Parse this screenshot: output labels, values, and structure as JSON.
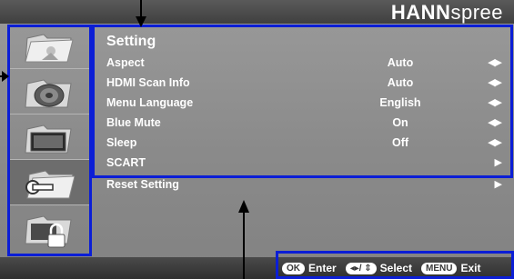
{
  "brand": {
    "bold": "HANN",
    "light": "spree"
  },
  "menu": {
    "title": "Setting",
    "items": [
      {
        "label": "Aspect",
        "value": "Auto",
        "arrows": "◀▶"
      },
      {
        "label": "HDMI Scan Info",
        "value": "Auto",
        "arrows": "◀▶"
      },
      {
        "label": "Menu Language",
        "value": "English",
        "arrows": "◀▶"
      },
      {
        "label": "Blue Mute",
        "value": "On",
        "arrows": "◀▶"
      },
      {
        "label": "Sleep",
        "value": "Off",
        "arrows": "◀▶"
      },
      {
        "label": "SCART",
        "value": "",
        "arrows": "▶"
      },
      {
        "label": "Reset Setting",
        "value": "",
        "arrows": "▶"
      }
    ]
  },
  "sidebar": {
    "items": [
      {
        "icon": "picture-folder-icon"
      },
      {
        "icon": "sound-speaker-folder-icon"
      },
      {
        "icon": "display-folder-icon"
      },
      {
        "icon": "setting-wrench-folder-icon",
        "active": true
      },
      {
        "icon": "lock-folder-icon"
      }
    ]
  },
  "hints": {
    "ok_key": "OK",
    "ok_label": "Enter",
    "nav_key": "◂▸/ ⇕",
    "nav_label": "Select",
    "menu_key": "MENU",
    "menu_label": "Exit"
  },
  "colors": {
    "highlight_frame": "#0b1ed6",
    "active_item": "#6d6d6d"
  }
}
